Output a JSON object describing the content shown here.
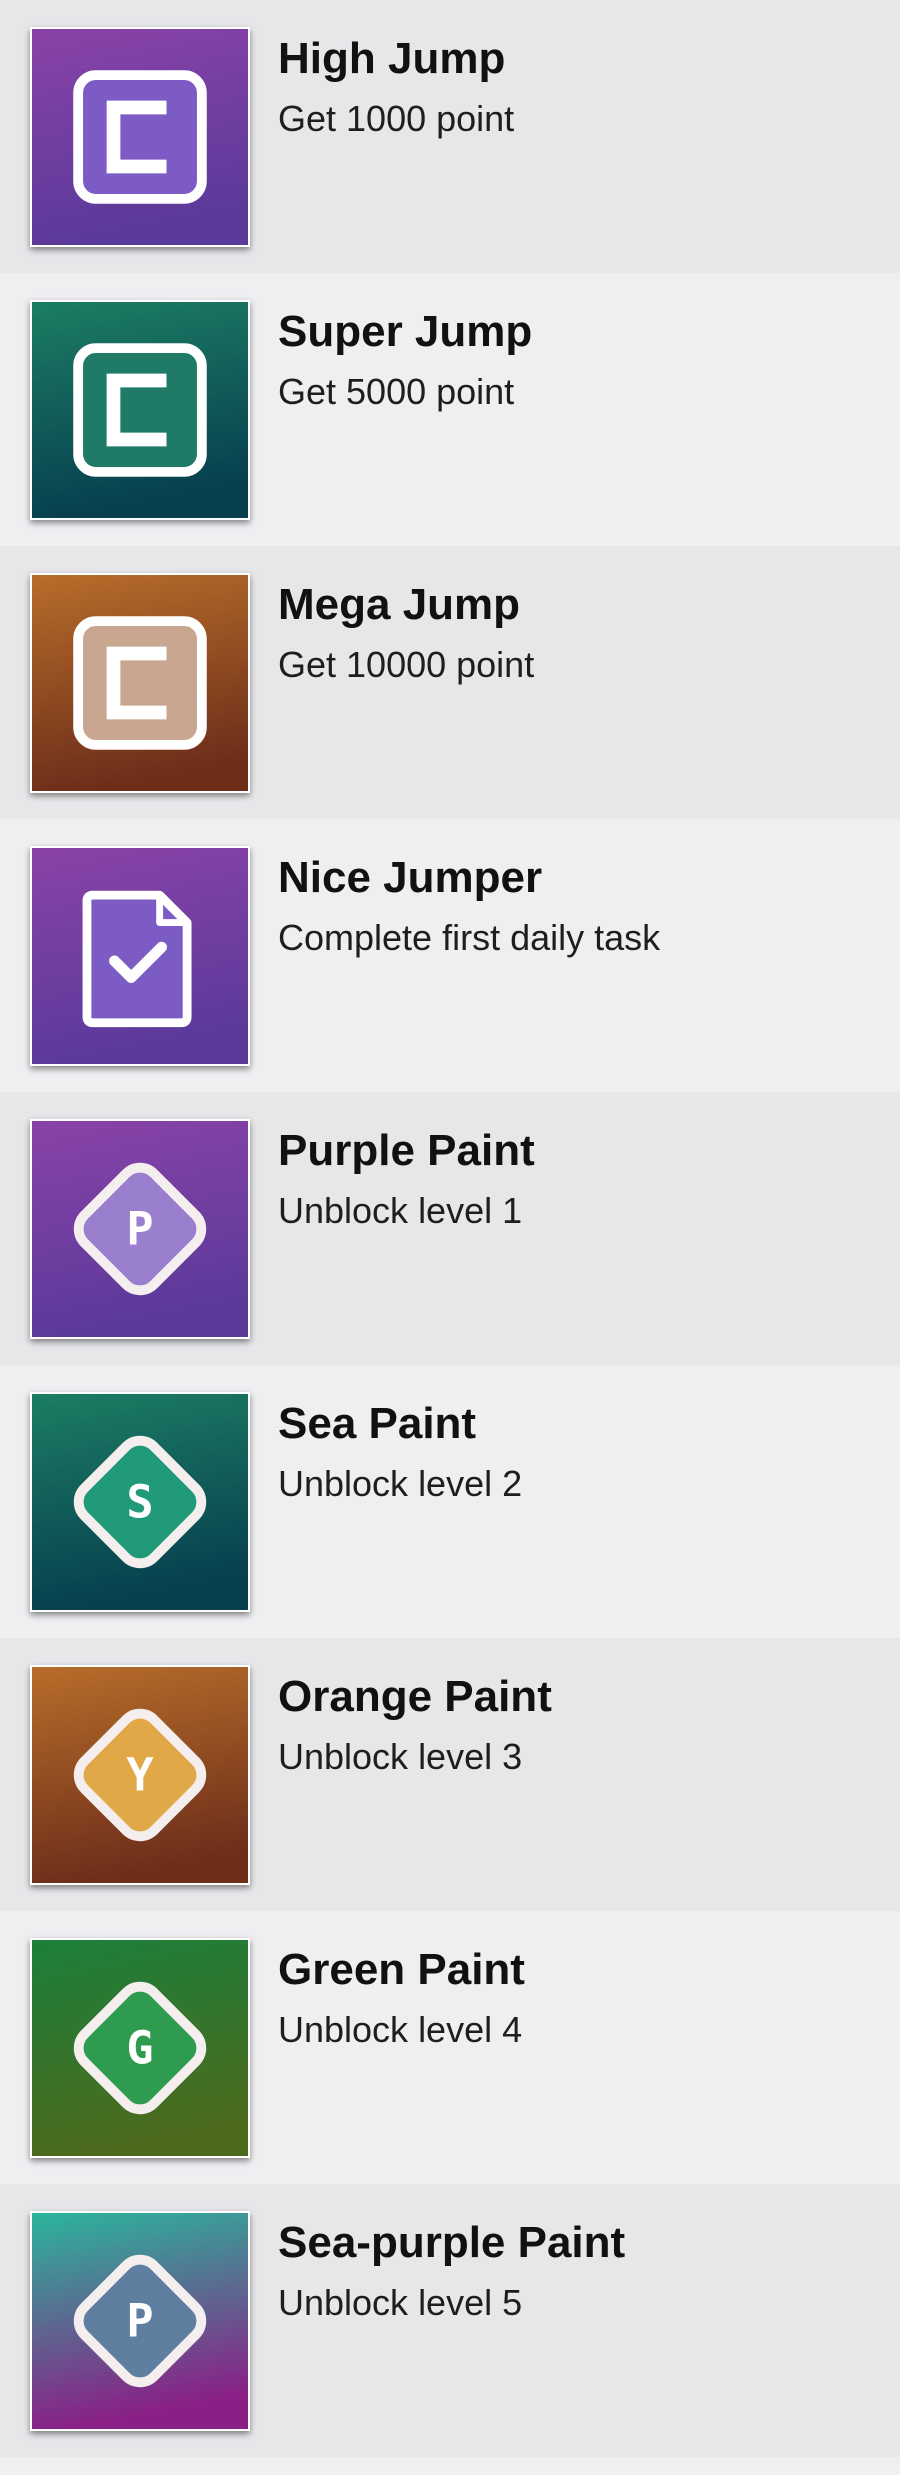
{
  "achievements": [
    {
      "title": "High Jump",
      "description": "Get 1000 point",
      "icon": "c-box-icon",
      "theme": "purple",
      "gradient": [
        "#8a42a8",
        "#5a3a9a"
      ],
      "glyph_fill": "#7c5cc4"
    },
    {
      "title": "Super Jump",
      "description": "Get 5000 point",
      "icon": "c-box-icon",
      "theme": "sea",
      "gradient": [
        "#1c7d63",
        "#073f4f"
      ],
      "glyph_fill": "#1f7a68"
    },
    {
      "title": "Mega Jump",
      "description": "Get 10000 point",
      "icon": "c-box-icon",
      "theme": "orange",
      "gradient": [
        "#b86d2a",
        "#6e2e1a"
      ],
      "glyph_fill": "#c9a690"
    },
    {
      "title": "Nice Jumper",
      "description": "Complete first daily task",
      "icon": "document-check-icon",
      "theme": "purple",
      "gradient": [
        "#8a42a8",
        "#5a3a9a"
      ],
      "glyph_fill": "#7c5cc4"
    },
    {
      "title": "Purple Paint",
      "description": "Unblock level 1",
      "icon": "diamond-p-icon",
      "letter": "P",
      "theme": "purple",
      "gradient": [
        "#8a42a8",
        "#5a3a9a"
      ],
      "glyph_fill": "#9b7fcf"
    },
    {
      "title": "Sea Paint",
      "description": "Unblock level 2",
      "icon": "diamond-s-icon",
      "letter": "S",
      "theme": "sea",
      "gradient": [
        "#1c7d63",
        "#073f4f"
      ],
      "glyph_fill": "#219a7a"
    },
    {
      "title": "Orange Paint",
      "description": "Unblock level 3",
      "icon": "diamond-y-icon",
      "letter": "Y",
      "theme": "orange",
      "gradient": [
        "#b86d2a",
        "#6e2e1a"
      ],
      "glyph_fill": "#e0a847"
    },
    {
      "title": "Green Paint",
      "description": "Unblock level 4",
      "icon": "diamond-g-icon",
      "letter": "G",
      "theme": "green",
      "gradient": [
        "#1b7f3a",
        "#4c6a1e"
      ],
      "glyph_fill": "#2f9b4f"
    },
    {
      "title": "Sea-purple Paint",
      "description": "Unblock level 5",
      "icon": "diamond-p-icon",
      "letter": "P",
      "theme": "sea-purple",
      "gradient": [
        "#2bb59c",
        "#8a1f86"
      ],
      "glyph_fill": "#5f7fa0"
    }
  ]
}
